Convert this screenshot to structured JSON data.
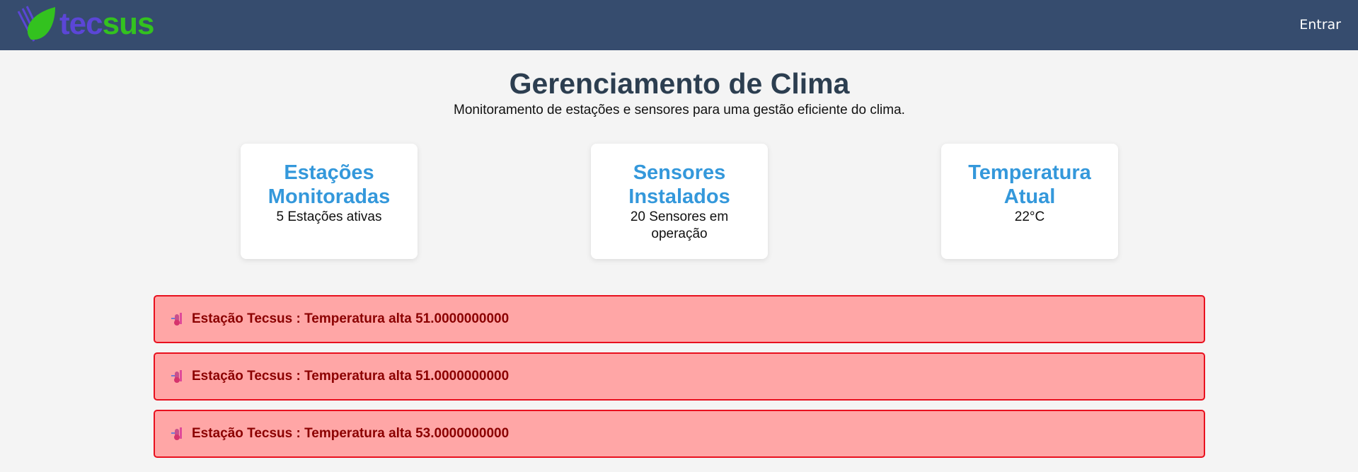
{
  "header": {
    "logo_tec": "tec",
    "logo_sus": "sus",
    "login_label": "Entrar"
  },
  "main": {
    "title": "Gerenciamento de Clima",
    "subtitle": "Monitoramento de estações e sensores para uma gestão eficiente do clima."
  },
  "cards": [
    {
      "title": "Estações Monitoradas",
      "text": "5 Estações ativas"
    },
    {
      "title": "Sensores Instalados",
      "text": "20 Sensores em operação"
    },
    {
      "title": "Temperatura Atual",
      "text": "22°C"
    }
  ],
  "alerts": [
    {
      "text": "Estação Tecsus : Temperatura alta 51.0000000000",
      "icon": "thermometer-icon"
    },
    {
      "text": "Estação Tecsus : Temperatura alta 51.0000000000",
      "icon": "thermometer-icon"
    },
    {
      "text": "Estação Tecsus : Temperatura alta 53.0000000000",
      "icon": "thermometer-icon"
    }
  ],
  "colors": {
    "navbar": "#364c6e",
    "accent": "#3498db",
    "alert_bg": "#ffa6a6",
    "alert_border": "#e8101e",
    "alert_text": "#8b0000",
    "logo_tec": "#5b46d6",
    "logo_sus": "#33c21f"
  }
}
